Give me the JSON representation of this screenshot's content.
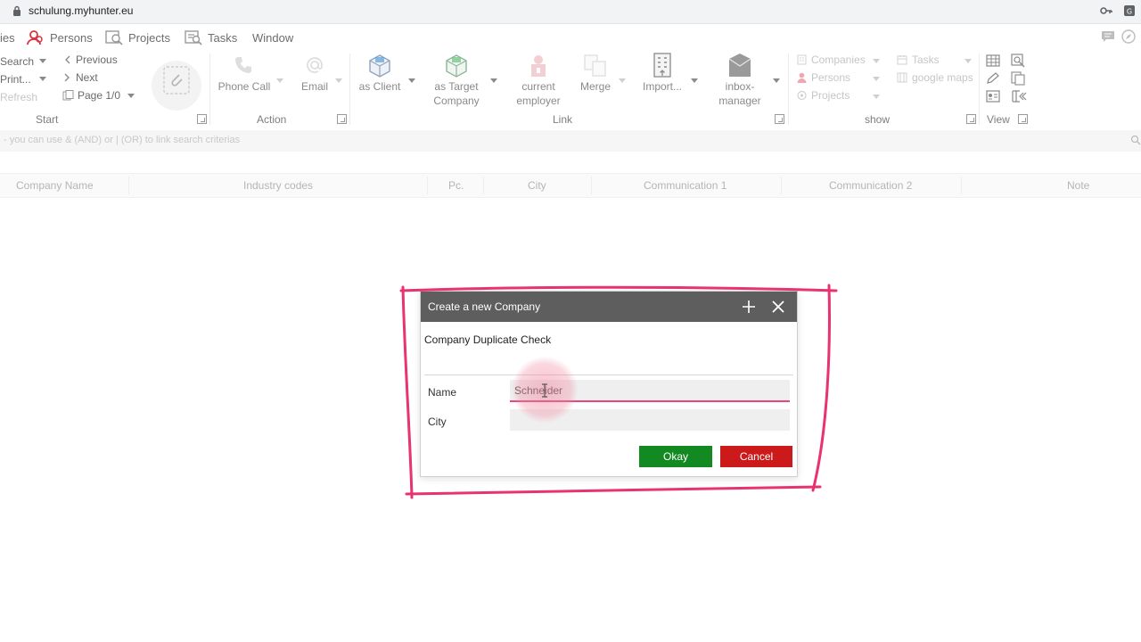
{
  "browser": {
    "url": "schulung.myhunter.eu"
  },
  "menu": {
    "items": [
      {
        "label": "ies"
      },
      {
        "label": "Persons"
      },
      {
        "label": "Projects"
      },
      {
        "label": "Tasks"
      },
      {
        "label": "Window"
      }
    ]
  },
  "ribbon": {
    "start": {
      "search": "Search",
      "print": "Print...",
      "refresh": "Refresh",
      "previous": "Previous",
      "next": "Next",
      "page": "Page 1/0",
      "group_label": "Start"
    },
    "action": {
      "phone_call": "Phone Call",
      "email": "Email",
      "group_label": "Action"
    },
    "link": {
      "as_client": "as Client",
      "as_target_line1": "as Target",
      "as_target_line2": "Company",
      "current_line1": "current",
      "current_line2": "employer",
      "merge": "Merge",
      "import": "Import...",
      "inbox_line1": "inbox-",
      "inbox_line2": "manager",
      "group_label": "Link"
    },
    "show": {
      "companies": "Companies",
      "persons": "Persons",
      "projects": "Projects",
      "tasks": "Tasks",
      "google_maps": "google maps",
      "group_label": "show"
    },
    "view": {
      "group_label": "View"
    }
  },
  "search_hint": "- you can use & (AND) or | (OR) to link search criterias",
  "table": {
    "columns": [
      "Company Name",
      "Industry codes",
      "Pc.",
      "City",
      "Communication 1",
      "Communication 2",
      "Note"
    ]
  },
  "dialog": {
    "title": "Create a new Company",
    "subtitle": "Company Duplicate Check",
    "name_label": "Name",
    "name_value": "Schneider",
    "city_label": "City",
    "city_value": "",
    "ok_label": "Okay",
    "cancel_label": "Cancel"
  },
  "colors": {
    "annotation": "#e8336f",
    "ok": "#138a21",
    "cancel": "#cc1a1a",
    "dialog_title": "#5e5e5e"
  }
}
